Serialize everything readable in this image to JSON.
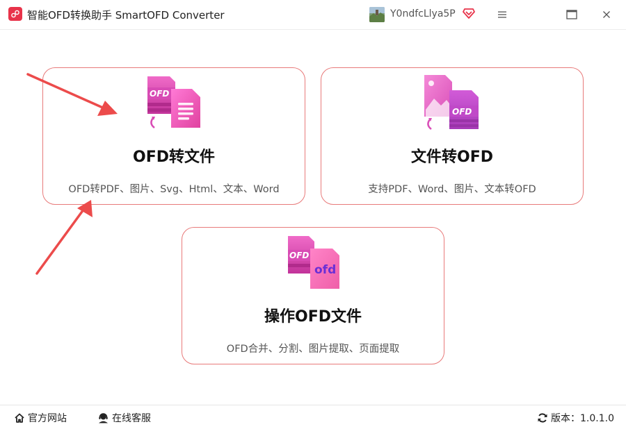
{
  "app": {
    "title": "智能OFD转换助手 SmartOFD Converter",
    "username": "Y0ndfcLlya5P",
    "accent_color": "#e8334a",
    "card_border_color": "#e87a7a"
  },
  "icons": {
    "logo": "app-logo-icon",
    "vip": "vip-diamond-icon",
    "menu": "hamburger-menu-icon",
    "maximize": "maximize-icon",
    "close": "close-icon"
  },
  "cards": [
    {
      "title": "OFD转文件",
      "description": "OFD转PDF、图片、Svg、Html、文本、Word",
      "icon": "ofd-to-file-icon"
    },
    {
      "title": "文件转OFD",
      "description": "支持PDF、Word、图片、文本转OFD",
      "icon": "file-to-ofd-icon"
    },
    {
      "title": "操作OFD文件",
      "description": "OFD合并、分割、图片提取、页面提取",
      "icon": "ofd-operate-icon"
    }
  ],
  "icon_badges": {
    "ofd_upper": "OFD",
    "ofd_lower": "ofd"
  },
  "footer": {
    "website_label": "官方网站",
    "service_label": "在线客服",
    "version_label": "版本：1.0.1.0"
  }
}
